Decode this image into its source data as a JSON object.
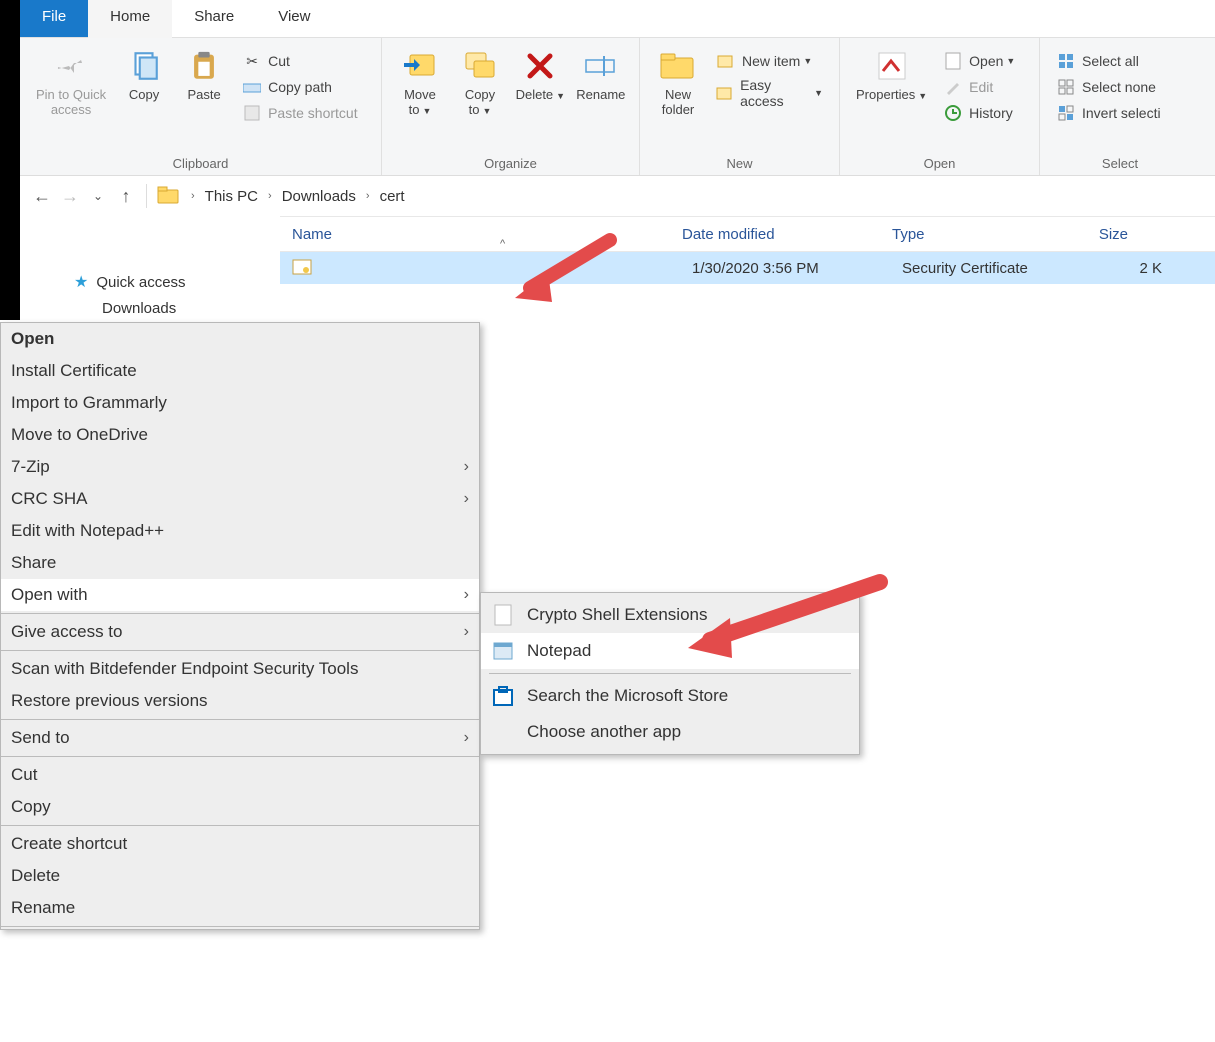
{
  "tabs": {
    "file": "File",
    "home": "Home",
    "share": "Share",
    "view": "View"
  },
  "ribbon": {
    "clipboard": {
      "title": "Clipboard",
      "pin": "Pin to Quick\naccess",
      "copy": "Copy",
      "paste": "Paste",
      "cut": "Cut",
      "copypath": "Copy path",
      "pasteshortcut": "Paste shortcut"
    },
    "organize": {
      "title": "Organize",
      "moveto": "Move\nto",
      "copyto": "Copy\nto",
      "delete": "Delete",
      "rename": "Rename"
    },
    "new": {
      "title": "New",
      "newfolder": "New\nfolder",
      "newitem": "New item",
      "easyaccess": "Easy access"
    },
    "open": {
      "title": "Open",
      "properties": "Properties",
      "open": "Open",
      "edit": "Edit",
      "history": "History"
    },
    "select": {
      "title": "Select",
      "selectall": "Select all",
      "selectnone": "Select none",
      "invert": "Invert selecti"
    }
  },
  "breadcrumb": {
    "pc": "This PC",
    "downloads": "Downloads",
    "cert": "cert"
  },
  "columns": {
    "name": "Name",
    "date": "Date modified",
    "type": "Type",
    "size": "Size"
  },
  "sidebar": {
    "quick": "Quick access",
    "downloads": "Downloads"
  },
  "file": {
    "date": "1/30/2020 3:56 PM",
    "type": "Security Certificate",
    "size": "2 K"
  },
  "ctx": {
    "open": "Open",
    "install": "Install Certificate",
    "grammarly": "Import to Grammarly",
    "onedrive": "Move to OneDrive",
    "sevenzip": "7-Zip",
    "crcsha": "CRC SHA",
    "npp": "Edit with Notepad++",
    "share": "Share",
    "openwith": "Open with",
    "giveaccess": "Give access to",
    "bitdefender": "Scan with Bitdefender Endpoint Security Tools",
    "restore": "Restore previous versions",
    "sendto": "Send to",
    "cut": "Cut",
    "copy": "Copy",
    "createshortcut": "Create shortcut",
    "delete": "Delete",
    "rename": "Rename"
  },
  "submenu": {
    "crypto": "Crypto Shell Extensions",
    "notepad": "Notepad",
    "store": "Search the Microsoft Store",
    "choose": "Choose another app"
  }
}
